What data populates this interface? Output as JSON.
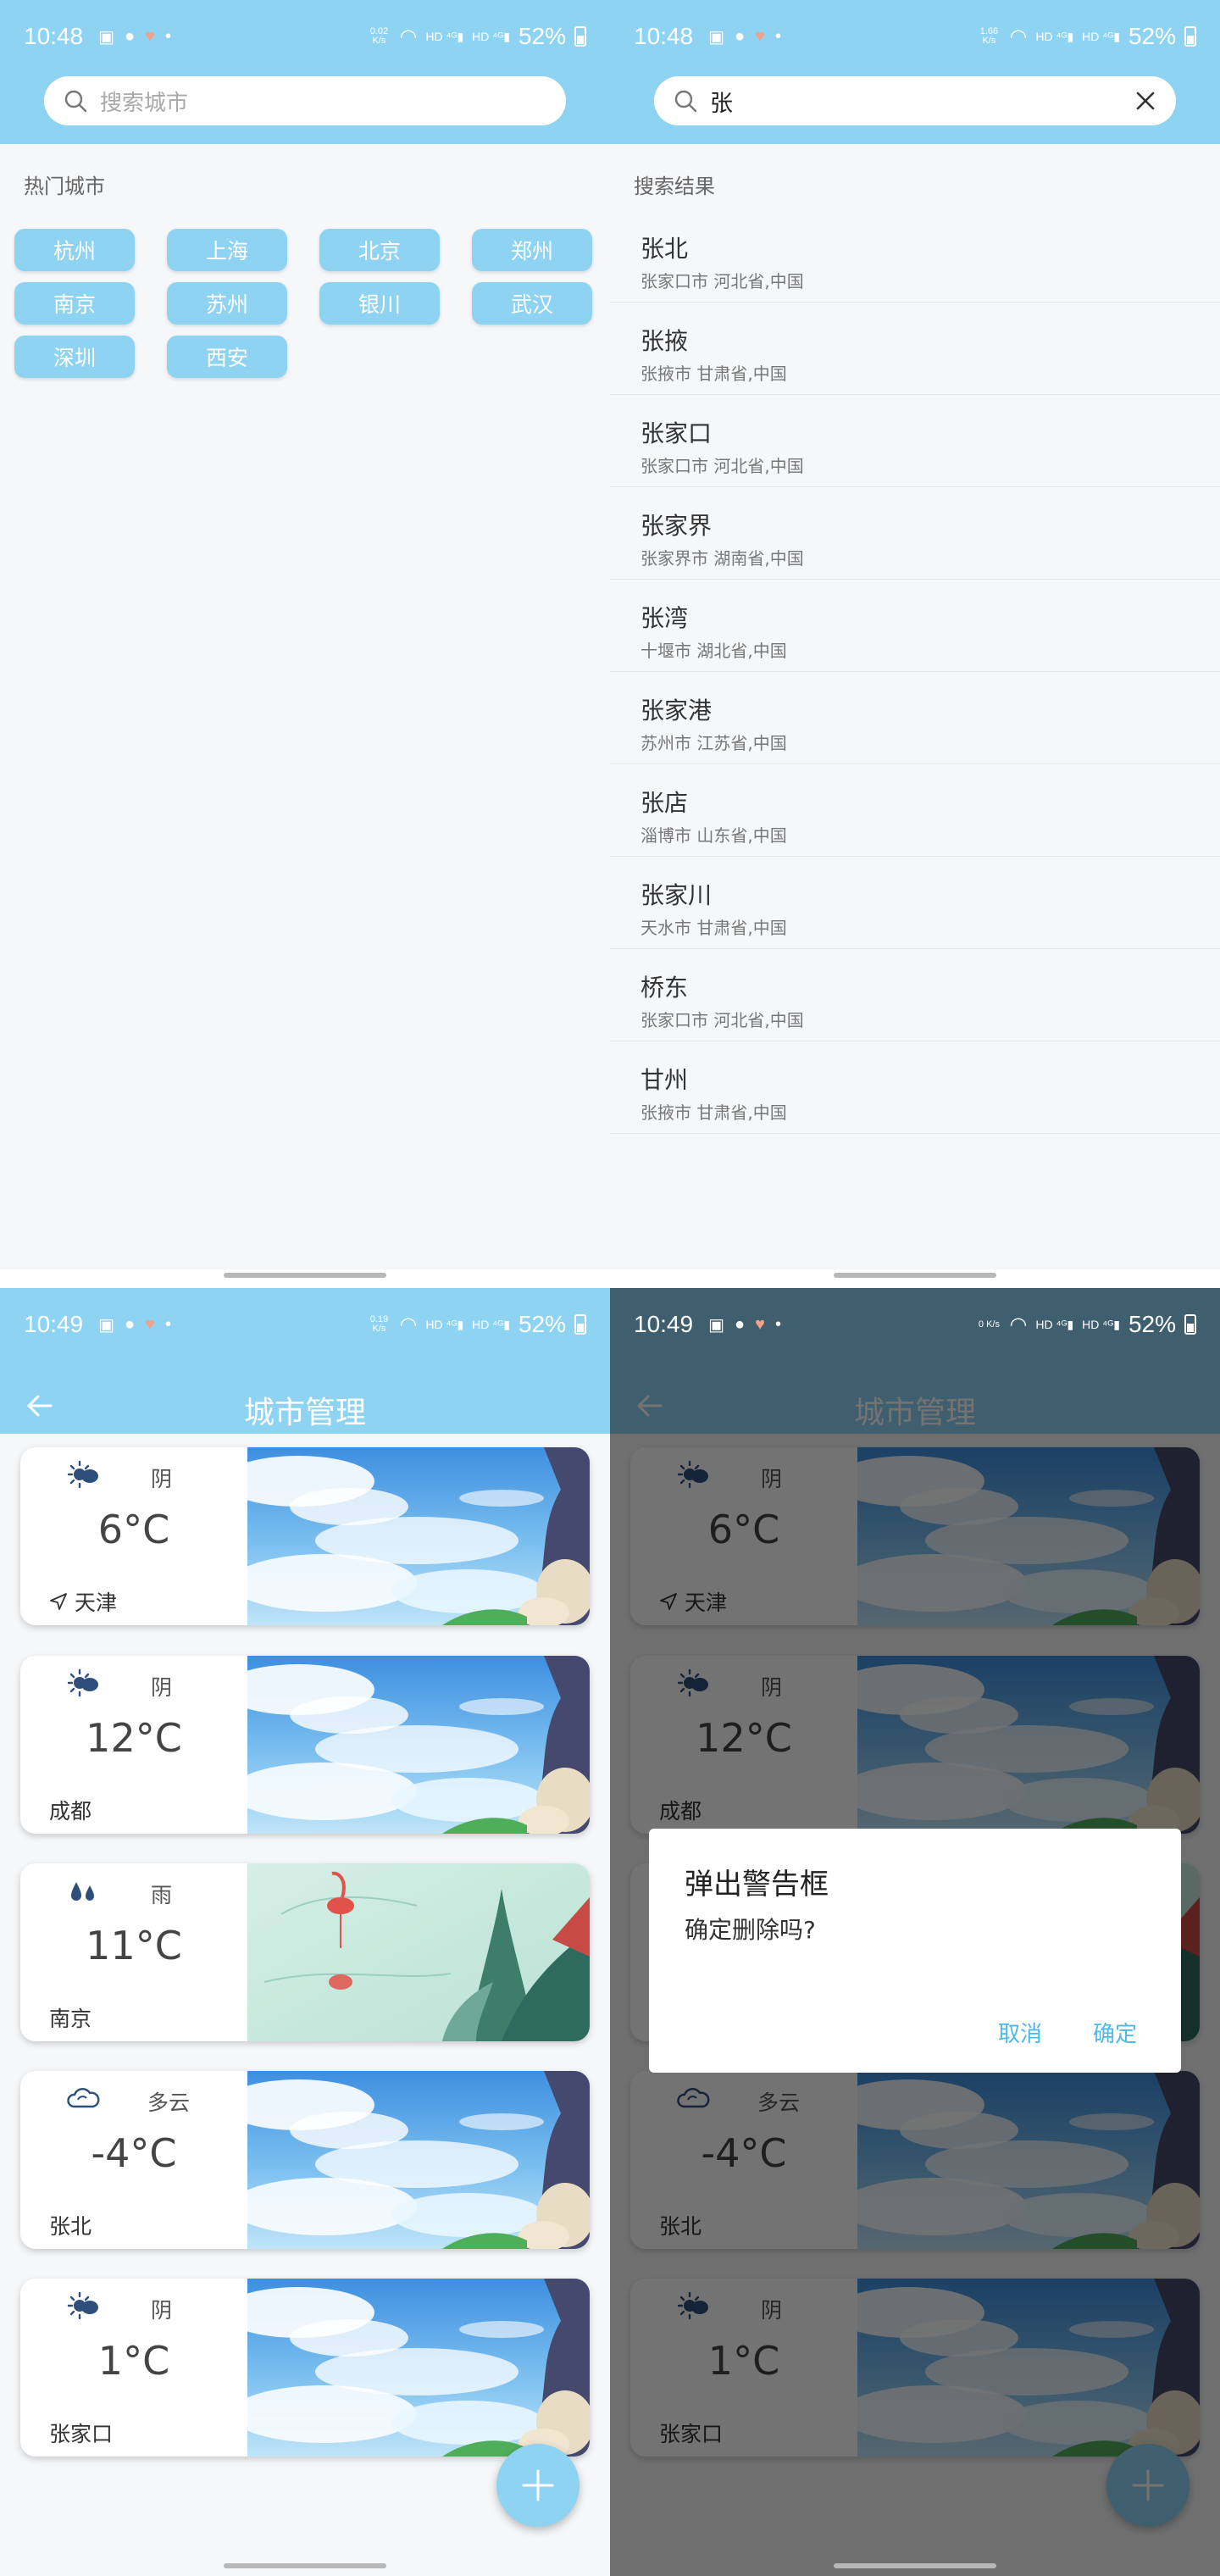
{
  "status_top": {
    "time": "10:48",
    "battery": "52%",
    "net_left": "0.02 K/s",
    "net_right": "1.66 K/s"
  },
  "status_bottom": {
    "time": "10:49",
    "battery": "52%",
    "net_left": "0.19 K/s",
    "net_right": "0 K/s"
  },
  "search_screen": {
    "placeholder": "搜索城市",
    "hot_label": "热门城市",
    "hot_cities": [
      "杭州",
      "上海",
      "北京",
      "郑州",
      "南京",
      "苏州",
      "银川",
      "武汉",
      "深圳",
      "西安"
    ]
  },
  "results_screen": {
    "query": "张",
    "results_label": "搜索结果",
    "results": [
      {
        "name": "张北",
        "region": "张家口市 河北省,中国"
      },
      {
        "name": "张掖",
        "region": "张掖市 甘肃省,中国"
      },
      {
        "name": "张家口",
        "region": "张家口市 河北省,中国"
      },
      {
        "name": "张家界",
        "region": "张家界市 湖南省,中国"
      },
      {
        "name": "张湾",
        "region": "十堰市 湖北省,中国"
      },
      {
        "name": "张家港",
        "region": "苏州市 江苏省,中国"
      },
      {
        "name": "张店",
        "region": "淄博市 山东省,中国"
      },
      {
        "name": "张家川",
        "region": "天水市 甘肃省,中国"
      },
      {
        "name": "桥东",
        "region": "张家口市 河北省,中国"
      },
      {
        "name": "甘州",
        "region": "张掖市 甘肃省,中国"
      }
    ]
  },
  "manage_screen": {
    "title": "城市管理",
    "cards": [
      {
        "condition": "阴",
        "temp": "6°C",
        "city": "天津",
        "icon": "overcast-icon",
        "image": "sky-clouds"
      },
      {
        "condition": "阴",
        "temp": "12°C",
        "city": "成都",
        "icon": "overcast-icon",
        "image": "sky-clouds"
      },
      {
        "condition": "雨",
        "temp": "11°C",
        "city": "南京",
        "icon": "rain-icon",
        "image": "flamingo-rain"
      },
      {
        "condition": "多云",
        "temp": "-4°C",
        "city": "张北",
        "icon": "cloudy-icon",
        "image": "sky-clouds"
      },
      {
        "condition": "阴",
        "temp": "1°C",
        "city": "张家口",
        "icon": "overcast-icon",
        "image": "sky-clouds"
      }
    ]
  },
  "dialog": {
    "title": "弹出警告框",
    "message": "确定删除吗?",
    "cancel": "取消",
    "confirm": "确定"
  },
  "colors": {
    "accent": "#8fd3f3",
    "dialog_button": "#4fb8e8",
    "background": "#f6f7f9"
  }
}
